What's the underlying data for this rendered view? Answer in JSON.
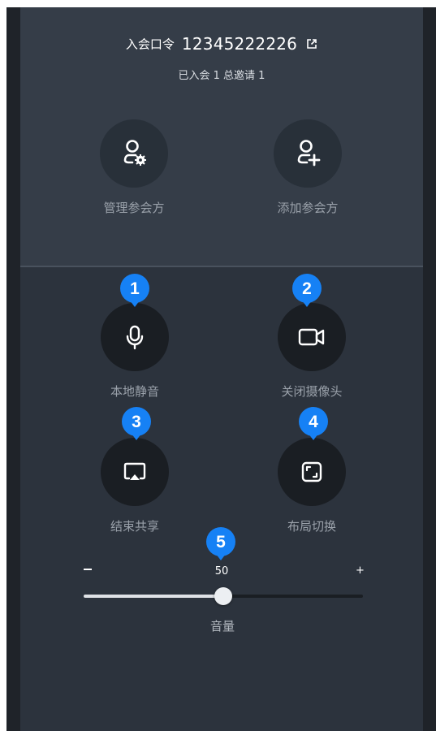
{
  "meeting": {
    "code_label": "入会口令",
    "code_value": "12345222226",
    "status_text": "已入会 1  总邀请 1"
  },
  "actions": {
    "manage": "管理参会方",
    "add": "添加参会方",
    "mute": "本地静音",
    "camera": "关闭摄像头",
    "share": "结束共享",
    "layout": "布局切换"
  },
  "badges": [
    "1",
    "2",
    "3",
    "4",
    "5"
  ],
  "volume": {
    "label": "音量",
    "value": 50,
    "value_text": "50",
    "max": 100,
    "minus_symbol": "-",
    "plus_symbol": "+"
  },
  "colors": {
    "badge": "#1681f5",
    "panel_top": "#353d48",
    "panel_bottom": "#2c333d"
  },
  "icons": [
    "external-link-icon",
    "user-settings-icon",
    "user-add-icon",
    "microphone-icon",
    "video-camera-icon",
    "screen-share-icon",
    "layout-icon"
  ]
}
